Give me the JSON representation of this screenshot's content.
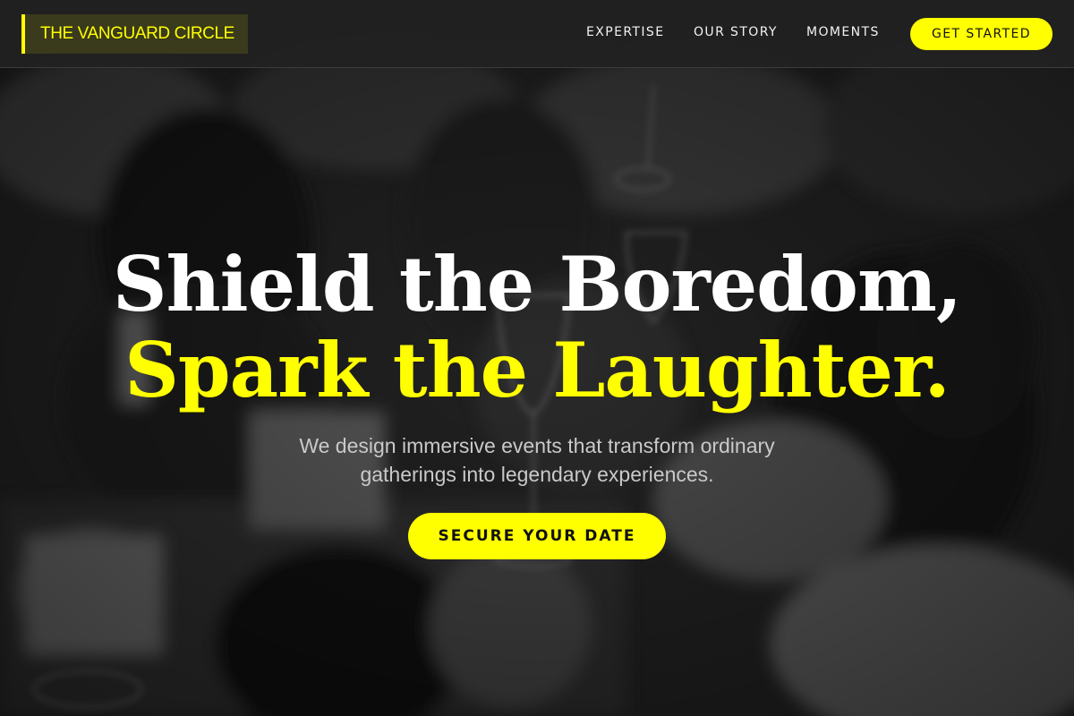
{
  "brand": {
    "name": "THE VANGUARD CIRCLE"
  },
  "nav": {
    "links": [
      {
        "label": "EXPERTISE"
      },
      {
        "label": "OUR STORY"
      },
      {
        "label": "MOMENTS"
      }
    ],
    "cta_label": "GET STARTED"
  },
  "hero": {
    "headline_line1": "Shield the Boredom,",
    "headline_line2": "Spark the Laughter.",
    "subtitle": "We design immersive events that transform ordinary gatherings into legendary experiences.",
    "cta_label": "SECURE YOUR DATE"
  },
  "colors": {
    "accent": "#ffff00",
    "nav_background": "#212121",
    "text_light": "#ffffff",
    "subtitle_text": "#c9c9cc"
  }
}
